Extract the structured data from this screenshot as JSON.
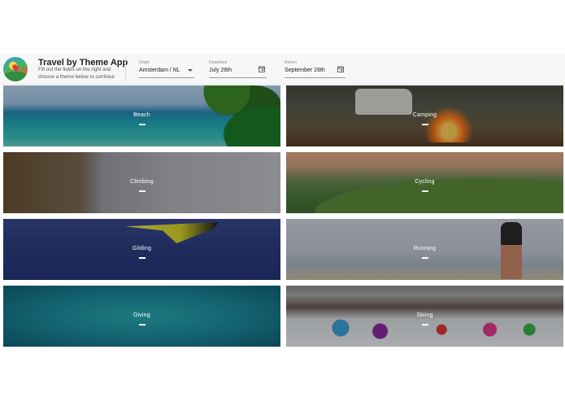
{
  "header": {
    "app_title": "Travel by Theme App",
    "app_subtitle": "Fill out the fields on the right and choose a theme below to continue",
    "origin": {
      "label": "Origin",
      "value": "Amsterdam / NL"
    },
    "departure": {
      "label": "Departure",
      "value": "July 28th"
    },
    "return": {
      "label": "Return",
      "value": "September 28th"
    }
  },
  "themes": [
    {
      "label": "Beach"
    },
    {
      "label": "Camping"
    },
    {
      "label": "Climbing"
    },
    {
      "label": "Cycling"
    },
    {
      "label": "Gliding"
    },
    {
      "label": "Running"
    },
    {
      "label": "Diving"
    },
    {
      "label": "Skiing"
    }
  ],
  "icons": {
    "logo": "travel-app-logo",
    "dropdown": "chevron-down-icon",
    "calendar": "calendar-icon"
  }
}
